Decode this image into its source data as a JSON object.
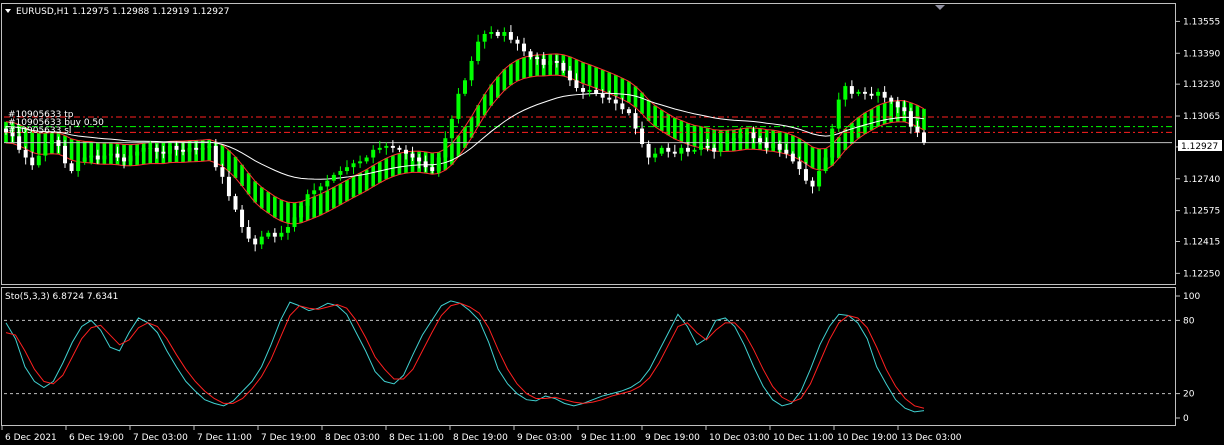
{
  "header": {
    "main_label": "EURUSD,H1  1.12975 1.12988 1.12919 1.12927",
    "sub_label": "Sto(5,3,3) 6.8724 7.6341",
    "price_tag": "1.12927"
  },
  "object_labels": [
    "#10905633 tp",
    "#10905633 buy 0.50",
    "#10905633 sl"
  ],
  "colors": {
    "background": "#000000",
    "bull_candle": "#00ff00",
    "bear_candle": "#ffffff",
    "band_fill": "#00ff00",
    "band_edge": "#ff3030",
    "slow_ma": "#ffffff",
    "stoch_main": "#40d0d0",
    "stoch_signal": "#ff2020",
    "level_red": "#ff2020",
    "level_green": "#00ff00",
    "grid_level": "#c0c0c0"
  },
  "chart_data": [
    {
      "type": "candlestick",
      "symbol": "EURUSD",
      "timeframe": "H1",
      "ohlc_last": {
        "open": 1.12975,
        "high": 1.12988,
        "low": 1.12919,
        "close": 1.12927
      },
      "y_ticks": [
        "1.13555",
        "1.13390",
        "1.13230",
        "1.13065",
        "1.12905",
        "1.12740",
        "1.12575",
        "1.12415",
        "1.12250"
      ],
      "ylim": [
        1.122,
        1.1364
      ],
      "x_ticks": [
        "6 Dec 2021",
        "6 Dec 19:00",
        "7 Dec 03:00",
        "7 Dec 11:00",
        "7 Dec 19:00",
        "8 Dec 03:00",
        "8 Dec 11:00",
        "8 Dec 19:00",
        "9 Dec 03:00",
        "9 Dec 11:00",
        "9 Dec 19:00",
        "10 Dec 03:00",
        "10 Dec 11:00",
        "10 Dec 19:00",
        "13 Dec 03:00"
      ],
      "close": [
        1.1298,
        1.1296,
        1.1289,
        1.1285,
        1.1281,
        1.1286,
        1.1292,
        1.1294,
        1.1291,
        1.1282,
        1.1278,
        1.1283,
        1.1285,
        1.1286,
        1.1284,
        1.1286,
        1.1287,
        1.1285,
        1.1283,
        1.1286,
        1.1288,
        1.129,
        1.129,
        1.1288,
        1.1287,
        1.1291,
        1.1289,
        1.1288,
        1.129,
        1.1289,
        1.129,
        1.1291,
        1.128,
        1.1275,
        1.1265,
        1.1258,
        1.1249,
        1.1243,
        1.124,
        1.1244,
        1.1246,
        1.1244,
        1.1246,
        1.1249,
        1.1254,
        1.126,
        1.1266,
        1.1268,
        1.127,
        1.1273,
        1.1276,
        1.1278,
        1.128,
        1.1282,
        1.1283,
        1.1285,
        1.1289,
        1.129,
        1.1291,
        1.129,
        1.1289,
        1.1287,
        1.1285,
        1.1283,
        1.128,
        1.1278,
        1.1285,
        1.1295,
        1.1305,
        1.1318,
        1.1325,
        1.1335,
        1.1345,
        1.1349,
        1.135,
        1.1348,
        1.135,
        1.1346,
        1.1344,
        1.134,
        1.1337,
        1.1336,
        1.1333,
        1.1335,
        1.1334,
        1.133,
        1.1325,
        1.1321,
        1.1319,
        1.132,
        1.1318,
        1.1316,
        1.1315,
        1.1313,
        1.131,
        1.1308,
        1.13,
        1.1292,
        1.1285,
        1.1287,
        1.129,
        1.1288,
        1.1287,
        1.129,
        1.1288,
        1.1289,
        1.1291,
        1.129,
        1.1288,
        1.1292,
        1.1294,
        1.1295,
        1.1297,
        1.1298,
        1.1295,
        1.1293,
        1.129,
        1.1292,
        1.1289,
        1.1287,
        1.1283,
        1.1279,
        1.1273,
        1.127,
        1.1278,
        1.1285,
        1.13,
        1.1315,
        1.1322,
        1.1318,
        1.1319,
        1.1318,
        1.1317,
        1.1319,
        1.1316,
        1.1314,
        1.1311,
        1.1309,
        1.1301,
        1.1298,
        1.12927
      ],
      "bands": {
        "upper": "ma_fast_upper",
        "lower": "ma_fast_lower"
      },
      "levels": [
        {
          "name": "take-profit",
          "value": 1.1306,
          "color": "#ff2020"
        },
        {
          "name": "entry",
          "value": 1.1301,
          "color": "#00ff00"
        },
        {
          "name": "stop-loss",
          "value": 1.1298,
          "color": "#ff2020"
        }
      ]
    },
    {
      "type": "line",
      "name": "Sto(5,3,3)",
      "ylim": [
        0,
        100
      ],
      "y_ticks": [
        "100",
        "80",
        "20",
        "0"
      ],
      "levels": [
        80,
        20
      ],
      "main": [
        78,
        65,
        42,
        30,
        25,
        30,
        45,
        62,
        75,
        80,
        72,
        58,
        55,
        70,
        82,
        78,
        70,
        55,
        42,
        30,
        22,
        15,
        12,
        10,
        14,
        22,
        30,
        42,
        60,
        80,
        95,
        92,
        88,
        90,
        94,
        92,
        85,
        70,
        55,
        38,
        30,
        28,
        35,
        52,
        68,
        80,
        92,
        96,
        94,
        88,
        80,
        62,
        40,
        28,
        20,
        15,
        14,
        18,
        16,
        12,
        10,
        12,
        15,
        18,
        20,
        22,
        25,
        30,
        40,
        55,
        70,
        85,
        75,
        60,
        65,
        80,
        82,
        75,
        60,
        42,
        26,
        15,
        10,
        12,
        22,
        40,
        60,
        75,
        85,
        84,
        78,
        65,
        42,
        28,
        15,
        8,
        5,
        6
      ],
      "signal": [
        70,
        68,
        55,
        40,
        30,
        28,
        35,
        50,
        65,
        74,
        76,
        68,
        60,
        64,
        74,
        78,
        75,
        65,
        52,
        40,
        30,
        22,
        16,
        12,
        12,
        16,
        24,
        34,
        48,
        66,
        84,
        92,
        90,
        89,
        91,
        93,
        90,
        80,
        66,
        50,
        40,
        32,
        32,
        40,
        55,
        70,
        84,
        92,
        94,
        91,
        86,
        74,
        56,
        40,
        28,
        20,
        16,
        16,
        17,
        15,
        13,
        12,
        13,
        15,
        18,
        20,
        22,
        26,
        33,
        45,
        60,
        75,
        78,
        70,
        64,
        72,
        78,
        78,
        70,
        56,
        40,
        26,
        17,
        13,
        16,
        28,
        46,
        64,
        78,
        84,
        82,
        74,
        58,
        40,
        26,
        16,
        10,
        8
      ]
    }
  ]
}
